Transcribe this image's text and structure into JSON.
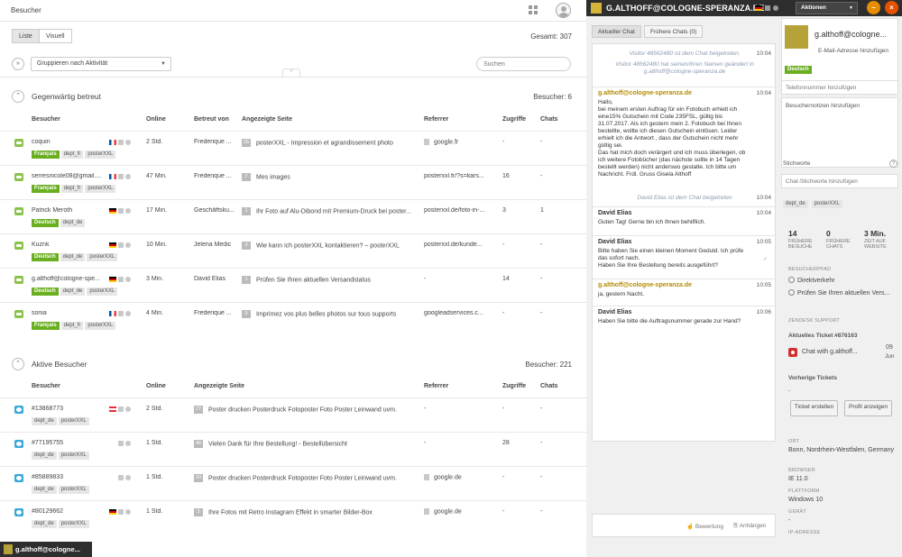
{
  "left": {
    "title": "Besucher",
    "view_list": "Liste",
    "view_visual": "Visuell",
    "total": "Gesamt: 307",
    "group_select": "Gruppieren nach Aktivität",
    "search_placeholder": "Suchen",
    "current": {
      "title": "Gegenwärtig betreut",
      "count": "Besucher: 6",
      "headers": [
        "Besucher",
        "Online",
        "Betreut von",
        "Angezeigte Seite",
        "Referrer",
        "Zugriffe",
        "Chats"
      ],
      "rows": [
        {
          "name": "coquin",
          "flag": "fr",
          "online": "2 Std.",
          "by": "Frederique ...",
          "badge": "26",
          "page": "posterXXL - Impression et agrandissement photo",
          "ref_icon": "doc",
          "referrer": "google.fr",
          "hits": "-",
          "chats": "-",
          "lang": "Français",
          "tags": [
            "dept_fr",
            "posterXXL"
          ]
        },
        {
          "name": "serresnicole08@gmail....",
          "flag": "fr",
          "online": "47 Min.",
          "by": "Frederique ...",
          "badge": "7",
          "page": "Mes images",
          "ref_icon": "search",
          "referrer": "posterxxl.fr/?s=kars...",
          "hits": "16",
          "chats": "-",
          "lang": "Français",
          "tags": [
            "dept_fr",
            "posterXXL"
          ]
        },
        {
          "name": "Patrick Meroth",
          "flag": "de",
          "online": "17 Min.",
          "by": "Geschäftsku...",
          "badge": "1",
          "page": "Ihr Foto auf Alu-Dibond mit Premium-Druck bei poster...",
          "ref_icon": "search",
          "referrer": "posterxxl.de/foto-in-...",
          "hits": "3",
          "chats": "1",
          "lang": "Deutsch",
          "tags": [
            "dept_de"
          ]
        },
        {
          "name": "Kuznk",
          "flag": "de",
          "online": "10 Min.",
          "by": "Jelena Medic",
          "badge": "3",
          "page": "Wie kann ich posterXXL kontaktieren? – posterXXL",
          "ref_icon": "search",
          "referrer": "posterxxl.de/kunde...",
          "hits": "-",
          "chats": "-",
          "lang": "Deutsch",
          "tags": [
            "dept_de",
            "posterXXL"
          ]
        },
        {
          "name": "g.althoff@cologne-spe...",
          "flag": "de",
          "online": "3 Min.",
          "by": "David Elias",
          "badge": "1",
          "page": "Prüfen Sie Ihren aktuellen Versandstatus",
          "ref_icon": "search",
          "referrer": "-",
          "hits": "14",
          "chats": "-",
          "lang": "Deutsch",
          "tags": [
            "dept_de",
            "posterXXL"
          ]
        },
        {
          "name": "sonia",
          "flag": "fr",
          "online": "4 Min.",
          "by": "Frederique ...",
          "badge": "5",
          "page": "Imprimez vos plus belles photos sur tous supports",
          "ref_icon": "search",
          "referrer": "googleadservices.c...",
          "hits": "-",
          "chats": "-",
          "lang": "Français",
          "tags": [
            "dept_fr",
            "posterXXL"
          ]
        }
      ]
    },
    "active": {
      "title": "Aktive Besucher",
      "count": "Besucher: 221",
      "headers": [
        "Besucher",
        "Online",
        "Angezeigte Seite",
        "Referrer",
        "Zugriffe",
        "Chats"
      ],
      "rows": [
        {
          "name": "#13868773",
          "flag": "at",
          "online": "2 Std.",
          "badge": "27",
          "page": "Poster drucken Posterdruck Fotoposter Foto Poster Leinwand uvm.",
          "ref_icon": "search",
          "referrer": "-",
          "hits": "-",
          "chats": "-",
          "tags": [
            "dept_de",
            "posterXXL"
          ]
        },
        {
          "name": "#77195755",
          "flag": "",
          "online": "1 Std.",
          "badge": "46",
          "page": "Vielen Dank für Ihre Bestellung! - Bestellübersicht",
          "ref_icon": "search",
          "referrer": "-",
          "hits": "28",
          "chats": "-",
          "tags": [
            "dept_de",
            "posterXXL"
          ]
        },
        {
          "name": "#85889833",
          "flag": "",
          "online": "1 Std.",
          "badge": "10",
          "page": "Poster drucken Posterdruck Fotoposter Foto Poster Leinwand uvm.",
          "ref_icon": "doc",
          "referrer": "google.de",
          "hits": "-",
          "chats": "-",
          "tags": [
            "dept_de",
            "posterXXL"
          ]
        },
        {
          "name": "#80129662",
          "flag": "de",
          "online": "1 Std.",
          "badge": "3",
          "page": "Ihre Fotos mit Retro Instagram Effekt in smarter Bilder-Box",
          "ref_icon": "doc",
          "referrer": "google.de",
          "hits": "-",
          "chats": "-",
          "tags": [
            "dept_de",
            "posterXXL"
          ]
        }
      ]
    }
  },
  "right": {
    "title": "G.ALTHOFF@COLOGNE-SPERANZA.DE",
    "actions": "Aktionen",
    "min_label": "–",
    "close_label": "×",
    "tab_current": "Aktueller Chat",
    "tab_previous": "Frühere Chats (0)",
    "sys1": "Visitor 48562480 ist dem Chat beigetreten.",
    "sys1_time": "10:04",
    "sys2": "Visitor 48562480 hat seinen/ihren Namen geändert in g.althoff@cologne-speranza.de",
    "messages": [
      {
        "who": "g.althoff@cologne-speranza.de",
        "op": true,
        "time": "10:04",
        "body": "Hallo,\nbei meinem ersten Auftrag für ein Fotobuch erhielt ich eine15% Gutschein mit Code 235FSL, gültig bis 31.07.2017. Als ich gestern mein 2. Fotobuch bei Ihnen bestellte, wollte ich diesen Gutschein einlösen. Leider erhielt ich die Antwort , dass der Gutschein nicht mehr gültig sei.\nDas hat mich doch verärgert und ich muss überlegen, ob ich weitere Fotobücher (das nächste sollte in 14 Tagen bestellt werden) nicht anderswo gestalte. Ich bitte um Nachricht. Frdl. Gruss Gisela Althoff"
      },
      {
        "who": "David Elias",
        "op": false,
        "time": "10:04",
        "body": "Guten Tag! Gerne bin ich Ihnen behilflich."
      },
      {
        "who": "David Elias",
        "op": false,
        "time": "10:05",
        "body": "Bitte haben Sie einen kleinen Moment Geduld. Ich prüfe das sofort nach.\nHaben Sie Ihre Bestellung bereits ausgeführt?"
      },
      {
        "who": "g.althoff@cologne-speranza.de",
        "op": true,
        "time": "10:05",
        "body": "ja, gestern Nacht."
      },
      {
        "who": "David Elias",
        "op": false,
        "time": "10:06",
        "body": "Haben Sie bitte die Auftragsnummer gerade zur Hand?"
      }
    ],
    "sys3": "David Elias ist dem Chat beigetreten",
    "sys3_time": "10:04",
    "footer_rating": "Bewertung",
    "footer_attach": "Anhängen",
    "profile_name": "g.althoff@cologne...",
    "email_placeholder": "E-Mail-Adresse hinzufügen",
    "lang_tag": "Deutsch",
    "phone_placeholder": "Telefonnummer hinzufügen",
    "notes_placeholder": "Besuchernotizen hinzufügen",
    "keywords_label": "Stichworte",
    "help_label": "?",
    "keywords_placeholder": "Chat-Stichworte hinzufügen",
    "tags": [
      "dept_de",
      "posterXXL"
    ],
    "stats": [
      {
        "v": "14",
        "l": "FRÜHERE BESUCHE"
      },
      {
        "v": "0",
        "l": "FRÜHERE CHATS"
      },
      {
        "v": "3 Min.",
        "l": "ZEIT AUF WEBSITE"
      }
    ],
    "path_label": "BESUCHERPFAD",
    "path": [
      "Direktverkehr",
      "Prüfen Sie Ihren aktuellen Vers..."
    ],
    "zendesk_label": "ZENDESK SUPPORT",
    "current_ticket": "Aktuelles Ticket #876163",
    "ticket_text": "Chat with g.althoff...",
    "ticket_day": "09",
    "ticket_month": "Jun",
    "prev_tickets": "Vorherige Tickets",
    "prev_tickets_val": "-",
    "btn_ticket": "Ticket erstellen",
    "btn_profile": "Profil anzeigen",
    "ort_label": "ORT",
    "ort_val": "Bonn, Nordrhein-Westfalen, Germany",
    "browser_label": "BROWSER",
    "browser_val": "IE 11.0",
    "platform_label": "PLATTFORM",
    "platform_val": "Windows 10",
    "device_label": "GERÄT",
    "device_val": "-",
    "ip_label": "IP-ADRESSE"
  },
  "taskbar": {
    "label": "g.althoff@cologne..."
  }
}
